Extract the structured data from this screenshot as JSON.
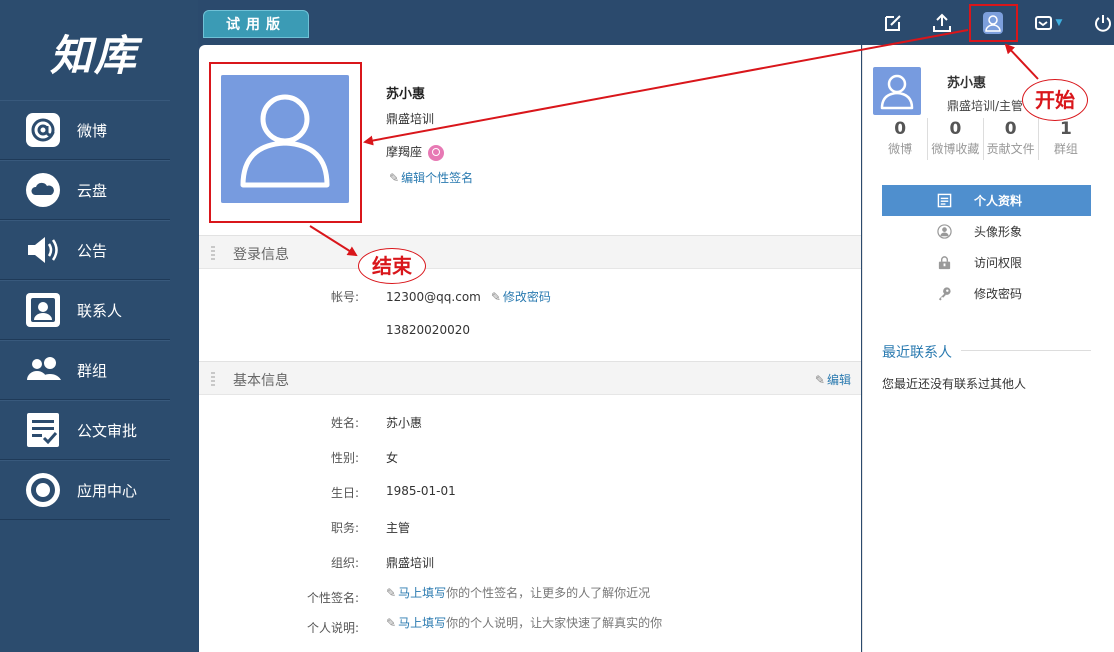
{
  "logo": "知库",
  "trial_label": "试用版",
  "nav": [
    {
      "label": "微博",
      "icon": "at-icon"
    },
    {
      "label": "云盘",
      "icon": "cloud-icon"
    },
    {
      "label": "公告",
      "icon": "speaker-icon"
    },
    {
      "label": "联系人",
      "icon": "contact-card-icon"
    },
    {
      "label": "群组",
      "icon": "group-icon"
    },
    {
      "label": "公文审批",
      "icon": "checklist-icon"
    },
    {
      "label": "应用中心",
      "icon": "target-icon"
    }
  ],
  "topbar": {
    "icons": [
      "compose-icon",
      "upload-icon",
      "user-icon",
      "mail-icon",
      "power-icon"
    ]
  },
  "profile": {
    "name": "苏小惠",
    "org": "鼎盛培训",
    "zodiac": "摩羯座",
    "edit_signature": "编辑个性签名"
  },
  "login_section": {
    "title": "登录信息",
    "account_label": "帐号:",
    "account_value": "12300@qq.com",
    "change_password": "修改密码",
    "phone_value": "13820020020"
  },
  "basic_section": {
    "title": "基本信息",
    "edit": "编辑",
    "fields": [
      {
        "label": "姓名:",
        "value": "苏小惠"
      },
      {
        "label": "性别:",
        "value": "女"
      },
      {
        "label": "生日:",
        "value": "1985-01-01"
      },
      {
        "label": "职务:",
        "value": "主管"
      },
      {
        "label": "组织:",
        "value": "鼎盛培训"
      }
    ],
    "signature_label": "个性签名:",
    "signature_link": "马上填写",
    "signature_hint": "你的个性签名，让更多的人了解你近况",
    "intro_label": "个人说明:",
    "intro_link": "马上填写",
    "intro_hint": "你的个人说明，让大家快速了解真实的你"
  },
  "right": {
    "name": "苏小惠",
    "org": "鼎盛培训/主管",
    "stats": [
      {
        "num": "0",
        "label": "微博"
      },
      {
        "num": "0",
        "label": "微博收藏"
      },
      {
        "num": "0",
        "label": "贡献文件"
      },
      {
        "num": "1",
        "label": "群组"
      }
    ],
    "menu": [
      {
        "label": "个人资料",
        "icon": "profile-doc-icon"
      },
      {
        "label": "头像形象",
        "icon": "avatar-icon"
      },
      {
        "label": "访问权限",
        "icon": "lock-icon"
      },
      {
        "label": "修改密码",
        "icon": "key-icon"
      }
    ],
    "recent_title": "最近联系人",
    "recent_empty": "您最近还没有联系过其他人"
  },
  "annotations": {
    "start": "开始",
    "end": "结束",
    "color": "#d9161b"
  }
}
